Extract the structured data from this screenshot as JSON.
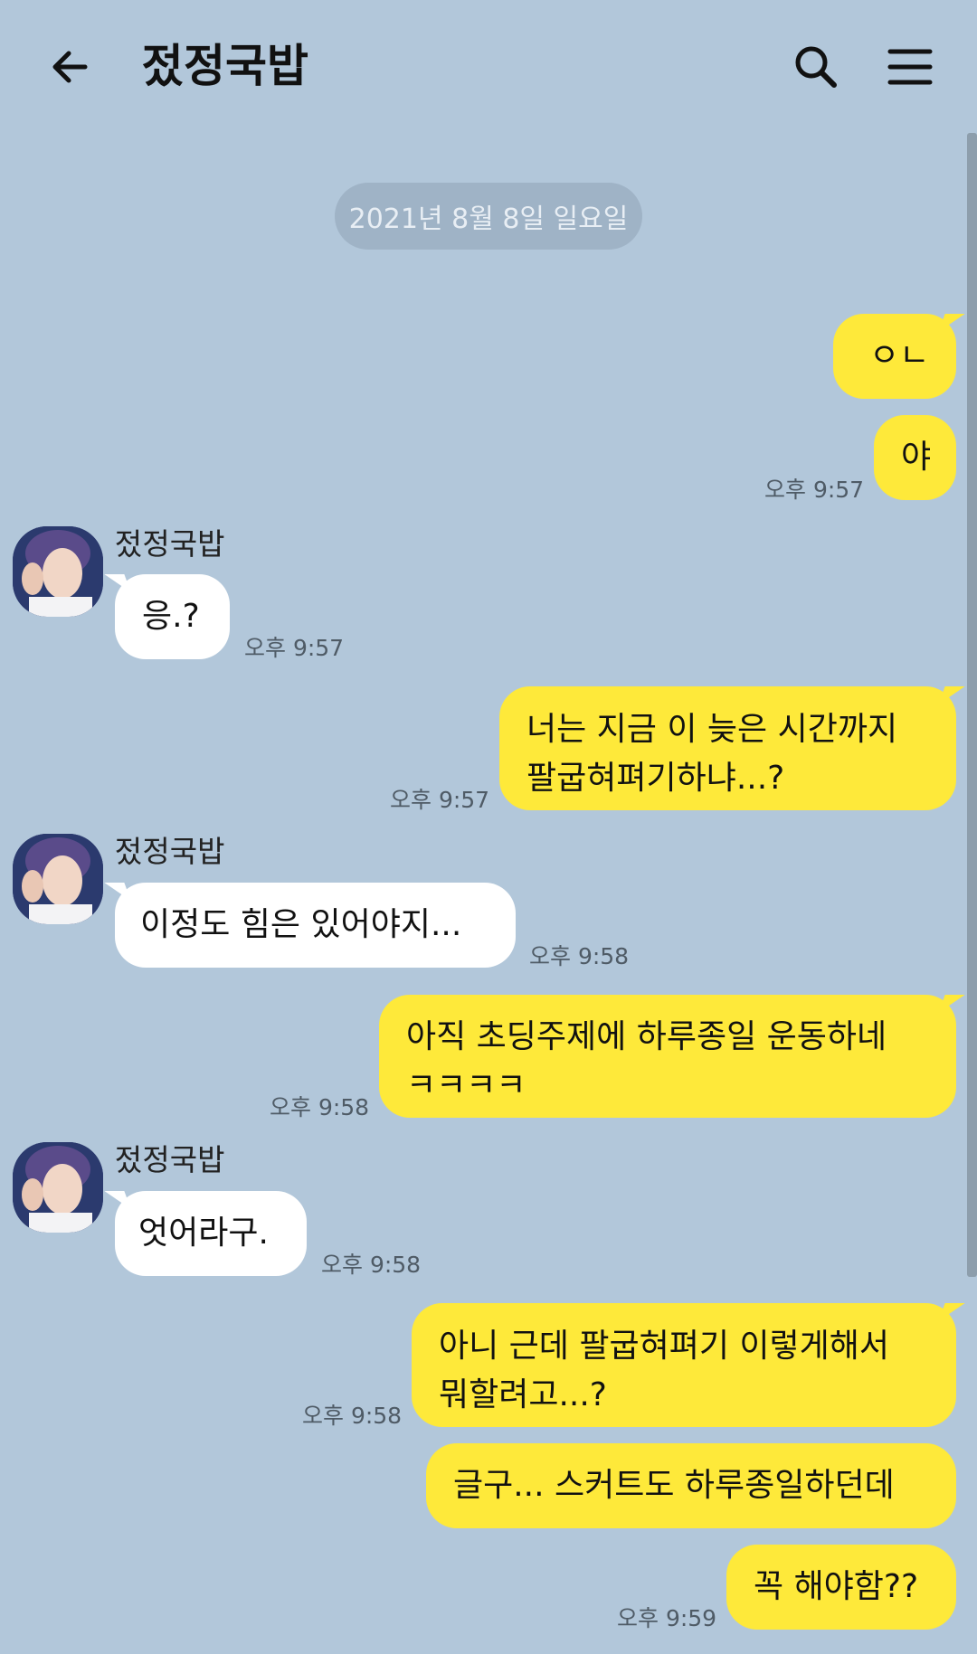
{
  "header": {
    "title": "젔정국밥"
  },
  "date_divider": "2021년 8월 8일 일요일",
  "messages": [
    {
      "sender": "me",
      "lines": [
        "ㅇㄴ"
      ]
    },
    {
      "sender": "me",
      "lines": [
        "야"
      ],
      "time": "오후 9:57"
    },
    {
      "sender": "them",
      "name": "젔정국밥",
      "lines": [
        "응.?"
      ],
      "time": "오후 9:57"
    },
    {
      "sender": "me",
      "lines": [
        "너는 지금 이 늦은 시간까지",
        "팔굽혀펴기하냐...?"
      ],
      "time": "오후 9:57"
    },
    {
      "sender": "them",
      "name": "젔정국밥",
      "lines": [
        "이정도 힘은 있어야지..."
      ],
      "time": "오후 9:58"
    },
    {
      "sender": "me",
      "lines": [
        "아직 초딩주제에 하루종일 운동하네",
        "ㅋㅋㅋㅋ"
      ],
      "time": "오후 9:58"
    },
    {
      "sender": "them",
      "name": "젔정국밥",
      "lines": [
        "엇어라구."
      ],
      "time": "오후 9:58"
    },
    {
      "sender": "me",
      "lines": [
        "아니 근데 팔굽혀펴기 이렇게해서",
        "뭐할려고...?"
      ],
      "time": "오후 9:58"
    },
    {
      "sender": "me",
      "lines": [
        "글구... 스커트도 하루종일하던데"
      ]
    },
    {
      "sender": "me",
      "lines": [
        "꼭 해야함??"
      ],
      "time": "오후 9:59"
    }
  ],
  "colors": {
    "background": "#b2c7da",
    "my_bubble": "#fee93a",
    "their_bubble": "#ffffff",
    "date_pill": "#9fb3c6"
  },
  "icons": {
    "back": "arrow-left-icon",
    "search": "search-icon",
    "menu": "hamburger-menu-icon"
  }
}
